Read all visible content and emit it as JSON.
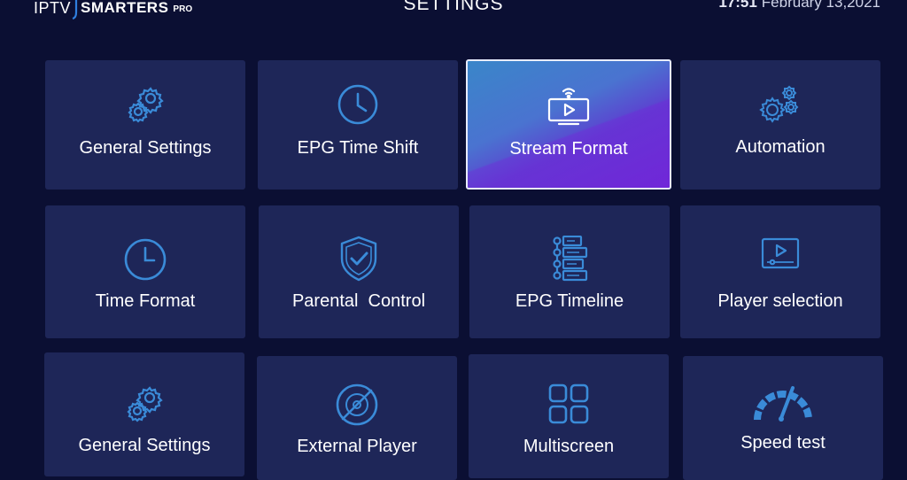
{
  "header": {
    "logo_iptv": "IPTV",
    "logo_smarters": "SMARTERS",
    "logo_pro": "PRO",
    "title": "SETTINGS",
    "time": "17:51",
    "date": "February 13,2021"
  },
  "colors": {
    "background": "#0b0f33",
    "tile": "#1e2658",
    "icon": "#3a8bd8",
    "selected_start": "#3a86c9",
    "selected_end": "#6c2bd6"
  },
  "tiles": [
    {
      "label": "General Settings",
      "icon": "gears-icon",
      "selected": false
    },
    {
      "label": "EPG Time Shift",
      "icon": "clock-icon",
      "selected": false
    },
    {
      "label": "Stream Format",
      "icon": "monitor-play-icon",
      "selected": true
    },
    {
      "label": "Automation",
      "icon": "automation-gears-icon",
      "selected": false
    },
    {
      "label": "Time Format",
      "icon": "clock-icon",
      "selected": false
    },
    {
      "label": "Parental  Control",
      "icon": "shield-check-icon",
      "selected": false
    },
    {
      "label": "EPG Timeline",
      "icon": "timeline-icon",
      "selected": false
    },
    {
      "label": "Player selection",
      "icon": "player-icon",
      "selected": false
    },
    {
      "label": "General Settings",
      "icon": "gears-icon",
      "selected": false
    },
    {
      "label": "External Player",
      "icon": "disc-slash-icon",
      "selected": false
    },
    {
      "label": "Multiscreen",
      "icon": "grid-icon",
      "selected": false
    },
    {
      "label": "Speed test",
      "icon": "speedometer-icon",
      "selected": false
    }
  ]
}
